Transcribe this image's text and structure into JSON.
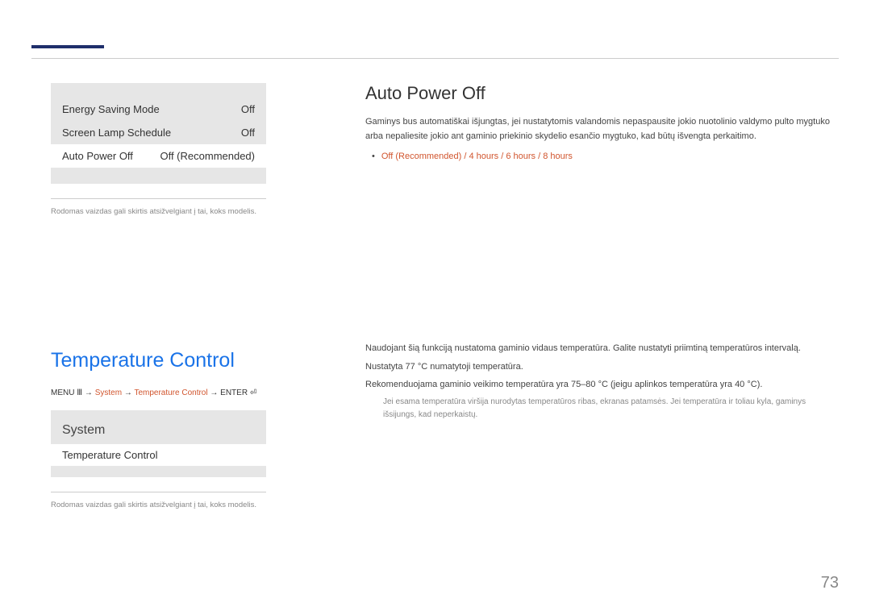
{
  "menu1": {
    "rows": [
      {
        "label": "Energy Saving Mode",
        "value": "Off"
      },
      {
        "label": "Screen Lamp Schedule",
        "value": "Off"
      },
      {
        "label": "Auto Power Off",
        "value": "Off (Recommended)"
      }
    ],
    "disclaimer": "Rodomas vaizdas gali skirtis atsižvelgiant į tai, koks modelis."
  },
  "section1": {
    "title": "Temperature Control",
    "breadcrumb": {
      "menu": "MENU",
      "arrow": "→",
      "system": "System",
      "temp": "Temperature Control",
      "enter": "ENTER"
    }
  },
  "menu2": {
    "title": "System",
    "item": "Temperature Control",
    "disclaimer": "Rodomas vaizdas gali skirtis atsižvelgiant į tai, koks modelis."
  },
  "right1": {
    "title": "Auto Power Off",
    "body": "Gaminys bus automatiškai išjungtas, jei nustatytomis valandomis nepaspausite jokio nuotolinio valdymo pulto mygtuko arba nepaliesite jokio ant gaminio priekinio skydelio esančio mygtuko, kad būtų išvengta perkaitimo.",
    "options": "Off (Recommended) / 4 hours / 6 hours / 8 hours"
  },
  "right2": {
    "p1": "Naudojant šią funkciją nustatoma gaminio vidaus temperatūra. Galite nustatyti priimtiną temperatūros intervalą.",
    "p2": "Nustatyta 77 °C numatytoji temperatūra.",
    "p3": "Rekomenduojama gaminio veikimo temperatūra yra 75–80 °C (jeigu aplinkos temperatūra yra 40 °C).",
    "p4": "Jei esama temperatūra viršija nurodytas temperatūros ribas, ekranas patamsės. Jei temperatūra ir toliau kyla, gaminys išsijungs, kad neperkaistų."
  },
  "pageNum": "73"
}
